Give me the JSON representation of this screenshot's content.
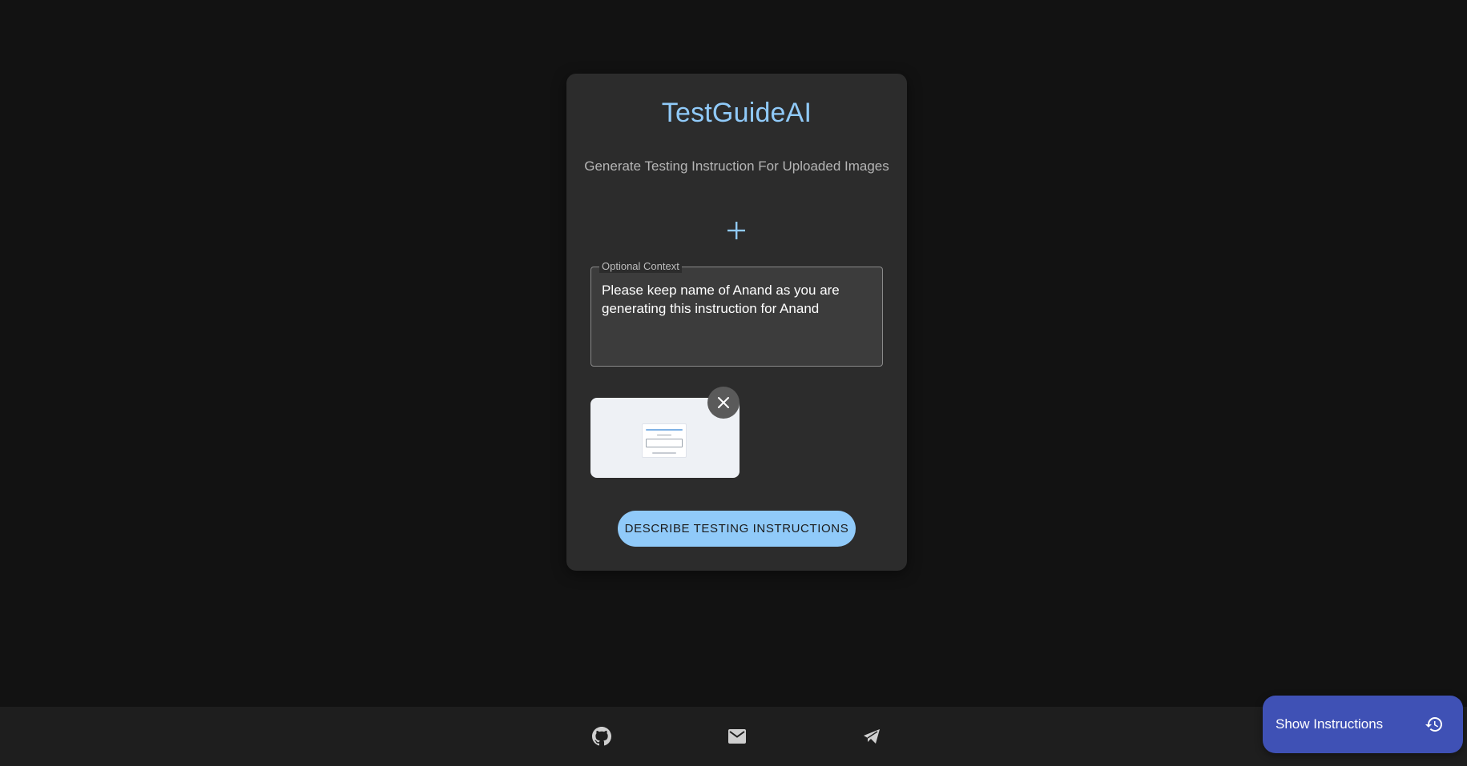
{
  "app": {
    "title": "TestGuideAI",
    "subtitle": "Generate Testing Instruction For Uploaded Images"
  },
  "upload": {
    "icon": "plus-icon"
  },
  "context": {
    "label": "Optional Context",
    "value": "Please keep name of Anand as you are generating this instruction for Anand"
  },
  "preview": {
    "remove_icon": "close-icon"
  },
  "actions": {
    "describe_label": "DESCRIBE TESTING INSTRUCTIONS"
  },
  "footer": {
    "links": [
      {
        "icon": "github-icon"
      },
      {
        "icon": "mail-icon"
      },
      {
        "icon": "telegram-icon"
      }
    ]
  },
  "fab": {
    "label": "Show Instructions",
    "icon": "history-icon"
  },
  "colors": {
    "background": "#121212",
    "card": "#2c2c2c",
    "accent": "#90caf9",
    "fab": "#3f51b5"
  }
}
